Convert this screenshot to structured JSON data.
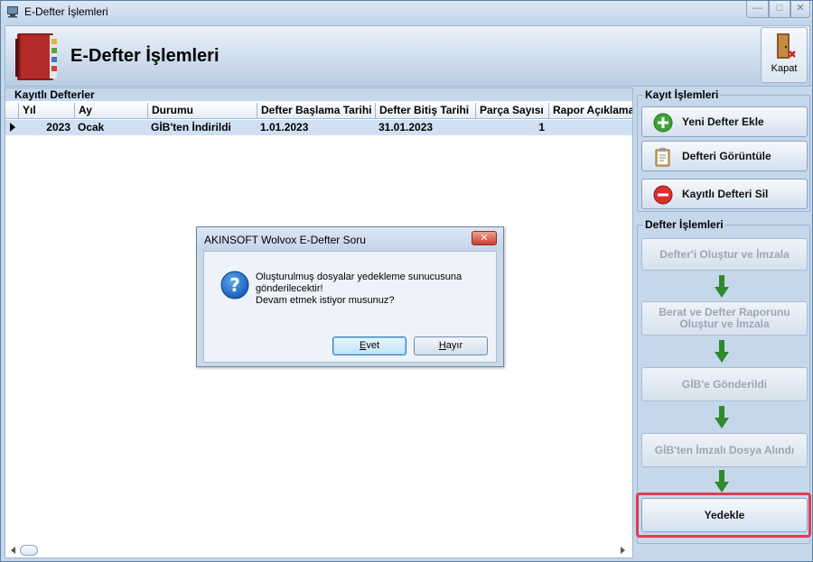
{
  "window": {
    "title": "E-Defter İşlemleri",
    "min_symbol": "—",
    "max_symbol": "□",
    "close_symbol": "✕"
  },
  "header": {
    "heading": "E-Defter İşlemleri",
    "close_label": "Kapat",
    "logo_icon": "ledger-book-icon",
    "close_icon": "exit-door-icon"
  },
  "ledgers": {
    "title": "Kayıtlı Defterler",
    "columns": [
      "Yıl",
      "Ay",
      "Durumu",
      "Defter Başlama Tarihi",
      "Defter Bitiş Tarihi",
      "Parça Sayısı",
      "Rapor Açıklama"
    ],
    "rows": [
      [
        "2023",
        "Ocak",
        "GİB'ten İndirildi",
        "1.01.2023",
        "31.01.2023",
        "1",
        ""
      ]
    ]
  },
  "record_ops": {
    "title": "Kayıt İşlemleri",
    "new_ledger": "Yeni Defter Ekle",
    "view_ledger": "Defteri Görüntüle",
    "delete_ledger": "Kayıtlı Defteri Sil"
  },
  "ledger_ops": {
    "title": "Defter İşlemleri",
    "step1": "Defter'i Oluştur ve İmzala",
    "step2_line1": "Berat ve Defter Raporunu",
    "step2_line2": "Oluştur ve İmzala",
    "step3": "GİB'e Gönderildi",
    "step4": "GİB'ten İmzalı Dosya Alındı",
    "step5": "Yedekle"
  },
  "dialog": {
    "title": "AKINSOFT Wolvox E-Defter Soru",
    "close_symbol": "✕",
    "message_line1": "Oluşturulmuş dosyalar yedekleme sunucusuna",
    "message_line2": "gönderilecektir!",
    "message_line3": "Devam etmek istiyor musunuz?",
    "yes_first": "E",
    "yes_rest": "vet",
    "no_first": "H",
    "no_rest": "ayır"
  },
  "colors": {
    "highlight": "#e23b4f",
    "window_bg": "#c5d7ea",
    "selected_row": "#cfe0f3"
  }
}
